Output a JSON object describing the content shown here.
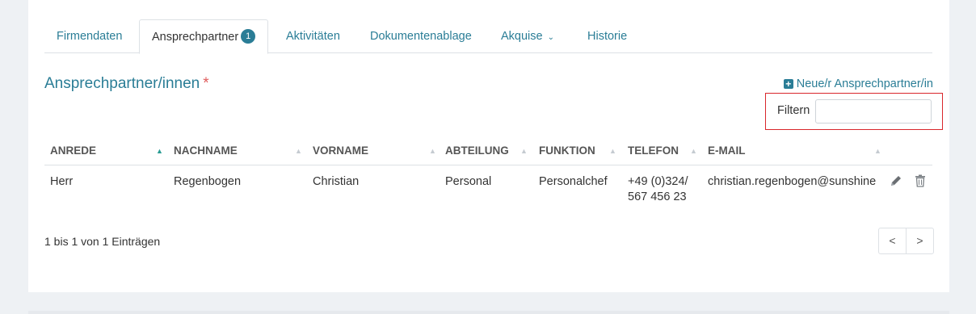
{
  "tabs": [
    {
      "label": "Firmendaten"
    },
    {
      "label": "Ansprechpartner",
      "badge": "1"
    },
    {
      "label": "Aktivitäten"
    },
    {
      "label": "Dokumentenablage"
    },
    {
      "label": "Akquise"
    },
    {
      "label": "Historie"
    }
  ],
  "section": {
    "title": "Ansprechpartner/innen",
    "required_mark": "*",
    "new_link": "Neue/r Ansprechpartner/in"
  },
  "filter": {
    "label": "Filtern",
    "value": ""
  },
  "table": {
    "columns": [
      "ANREDE",
      "NACHNAME",
      "VORNAME",
      "ABTEILUNG",
      "FUNKTION",
      "TELEFON",
      "E-MAIL"
    ],
    "rows": [
      {
        "anrede": "Herr",
        "nachname": "Regenbogen",
        "vorname": "Christian",
        "abteilung": "Personal",
        "funktion": "Personalchef",
        "telefon_line1": "+49 (0)324/",
        "telefon_line2": "567 456 23",
        "email": "christian.regenbogen@sunshine"
      }
    ]
  },
  "footer": {
    "info": "1 bis 1 von 1 Einträgen",
    "prev": "<",
    "next": ">"
  },
  "colors": {
    "accent": "#2a7d96",
    "highlight_box": "#d9262b"
  }
}
